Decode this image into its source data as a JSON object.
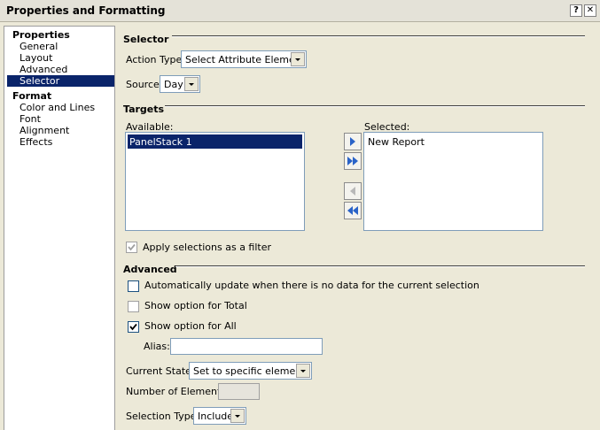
{
  "window": {
    "title": "Properties and Formatting",
    "help_glyph": "?",
    "close_glyph": "✕"
  },
  "nav": {
    "groups": [
      {
        "heading": "Properties",
        "items": [
          "General",
          "Layout",
          "Advanced",
          "Selector"
        ]
      },
      {
        "heading": "Format",
        "items": [
          "Color and Lines",
          "Font",
          "Alignment",
          "Effects"
        ]
      }
    ],
    "selected": "Selector"
  },
  "selector": {
    "heading": "Selector",
    "action_type_label": "Action Type:",
    "action_type_value": "Select Attribute Element",
    "source_label": "Source:",
    "source_value": "Day"
  },
  "targets": {
    "heading": "Targets",
    "available_label": "Available:",
    "available_items": [
      "PanelStack 1"
    ],
    "selected_label": "Selected:",
    "selected_items": [
      "New Report"
    ],
    "apply_filter_label": "Apply selections as a filter",
    "apply_filter_checked": true
  },
  "advanced": {
    "heading": "Advanced",
    "auto_update_label": "Automatically update when there is no data for the current selection",
    "auto_update_checked": false,
    "show_total_label": "Show option for Total",
    "show_total_checked": false,
    "show_all_label": "Show option for All",
    "show_all_checked": true,
    "alias_label": "Alias:",
    "alias_value": "",
    "current_state_label": "Current State:",
    "current_state_value": "Set to specific elements",
    "num_elements_label": "Number of Elements:",
    "num_elements_value": "",
    "selection_type_label": "Selection Type:",
    "selection_type_value": "Include"
  },
  "colors": {
    "selection": "#0a246a",
    "dialog_bg": "#ece9d8",
    "arrow_blue": "#2a63c8"
  }
}
